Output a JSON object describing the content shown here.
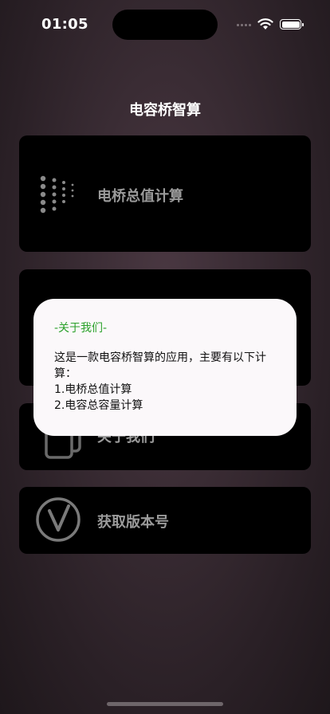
{
  "status_bar": {
    "time": "01:05"
  },
  "page_title": "电容桥智算",
  "cards": [
    {
      "label": "电桥总值计算",
      "icon": "dot-matrix-icon"
    },
    {
      "label": "",
      "icon": ""
    },
    {
      "label": "关于我们",
      "icon": "documents-icon"
    },
    {
      "label": "获取版本号",
      "icon": "version-check-icon"
    }
  ],
  "dialog": {
    "title": "-关于我们-",
    "body": "这是一款电容桥智算的应用，主要有以下计算：\n1.电桥总值计算\n2.电容总容量计算"
  },
  "colors": {
    "dialog_title": "#2aa12a",
    "card_bg": "#000000",
    "card_label": "#9a9a9a"
  }
}
